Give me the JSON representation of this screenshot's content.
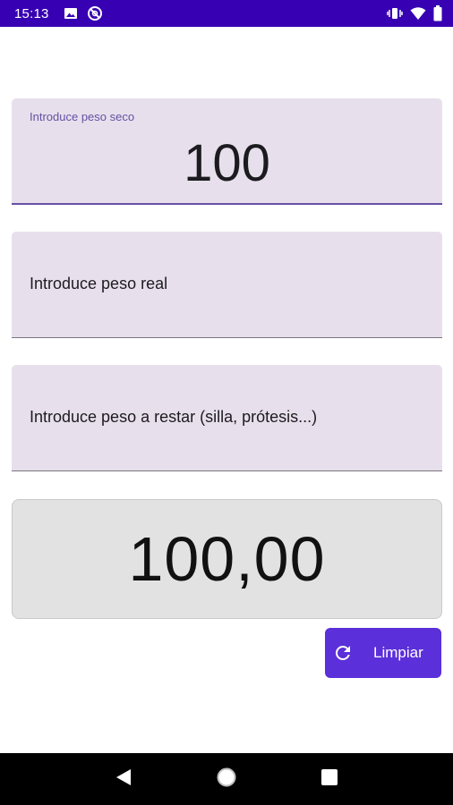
{
  "status_bar": {
    "time": "15:13",
    "left_icons": [
      "image-icon",
      "no-disturb-icon"
    ],
    "right_icons": [
      "vibrate-icon",
      "wifi-icon",
      "battery-icon"
    ],
    "background": "#3700b3"
  },
  "fields": {
    "dry_weight": {
      "label": "Introduce peso seco",
      "value": "100"
    },
    "real_weight": {
      "placeholder": "Introduce peso real"
    },
    "subtract_weight": {
      "placeholder": "Introduce peso a restar (silla, prótesis...)"
    }
  },
  "result": {
    "value": "100,00"
  },
  "clear_button": {
    "label": "Limpiar",
    "icon": "refresh-icon",
    "color": "#5b2fd9"
  },
  "nav_bar": {
    "buttons": [
      "back-icon",
      "home-icon",
      "recents-icon"
    ]
  }
}
